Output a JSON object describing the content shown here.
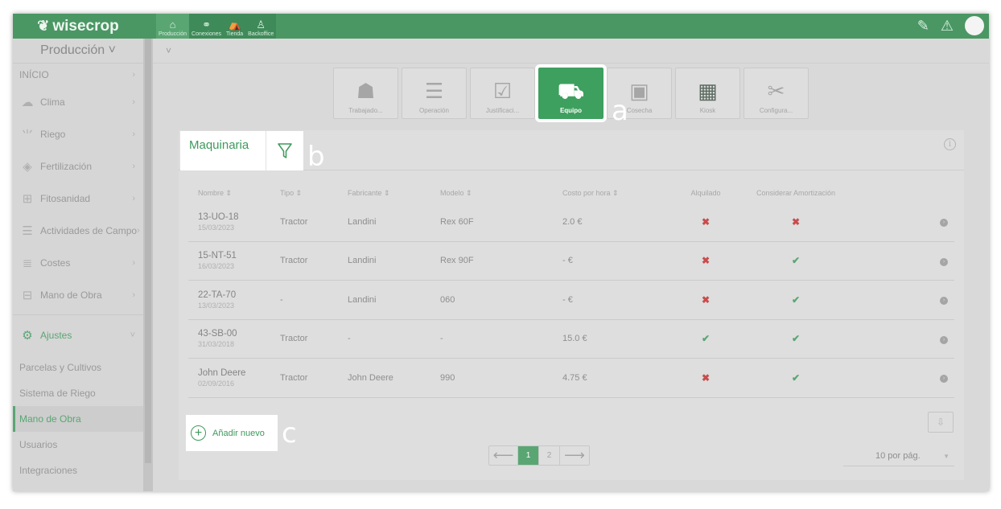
{
  "brand": {
    "name": "wisecrop"
  },
  "topnav": [
    {
      "label": "Producción",
      "icon": "farm-icon",
      "glyph": "⌂"
    },
    {
      "label": "Conexiones",
      "icon": "network-icon",
      "glyph": "⚭"
    },
    {
      "label": "Tienda",
      "icon": "store-icon",
      "glyph": "⛺"
    },
    {
      "label": "Backoffice",
      "icon": "admin-icon",
      "glyph": "♙"
    }
  ],
  "sidebar": {
    "title": "Producción ˅",
    "items": [
      {
        "label": "INÍCIO",
        "icon": "",
        "glyph": ""
      },
      {
        "label": "Clima",
        "icon": "cloud-icon",
        "glyph": "☁"
      },
      {
        "label": "Riego",
        "icon": "sprinkler-icon",
        "glyph": "⺌"
      },
      {
        "label": "Fertilización",
        "icon": "fertilizer-icon",
        "glyph": "◈"
      },
      {
        "label": "Fitosanidad",
        "icon": "medkit-icon",
        "glyph": "⊞"
      },
      {
        "label": "Actividades de Campo",
        "icon": "checklist-icon",
        "glyph": "☰"
      },
      {
        "label": "Costes",
        "icon": "coins-icon",
        "glyph": "≣"
      },
      {
        "label": "Mano de Obra",
        "icon": "worker-icon",
        "glyph": "⊟"
      }
    ],
    "ajustes": {
      "label": "Ajustes",
      "icon": "gear-icon",
      "glyph": "⚙"
    },
    "sub_items": [
      "Parcelas y Cultivos",
      "Sistema de Riego",
      "Mano de Obra",
      "Usuarios",
      "Integraciones"
    ],
    "active_sub": "Mano de Obra"
  },
  "tiles": [
    {
      "label": "Trabajado...",
      "icon": "worker-hat-icon",
      "glyph": "☗"
    },
    {
      "label": "Operación",
      "icon": "checklist-icon",
      "glyph": "☰"
    },
    {
      "label": "Justificaci...",
      "icon": "document-check-icon",
      "glyph": "☑"
    },
    {
      "label": "Equipo",
      "icon": "tractor-icon",
      "glyph": "⛟",
      "active": true
    },
    {
      "label": "Cosecha",
      "icon": "harvest-icon",
      "glyph": "▣"
    },
    {
      "label": "Kiosk",
      "icon": "qr-code-icon",
      "glyph": "▦"
    },
    {
      "label": "Configura...",
      "icon": "tools-icon",
      "glyph": "✂"
    }
  ],
  "callouts": {
    "a": "a",
    "b": "b",
    "c": "c"
  },
  "card": {
    "title": "Maquinaria"
  },
  "table": {
    "columns": [
      "Nombre ⇕",
      "Tipo ⇕",
      "Fabricante ⇕",
      "Modelo ⇕",
      "Costo por hora ⇕",
      "Alquilado",
      "Considerar Amortización"
    ],
    "rows": [
      {
        "name": "13-UO-18",
        "date": "15/03/2023",
        "tipo": "Tractor",
        "fabricante": "Landini",
        "modelo": "Rex 60F",
        "costo": "2.0 €",
        "alquilado": false,
        "amortizacion": false
      },
      {
        "name": "15-NT-51",
        "date": "16/03/2023",
        "tipo": "Tractor",
        "fabricante": "Landini",
        "modelo": "Rex 90F",
        "costo": "- €",
        "alquilado": false,
        "amortizacion": true
      },
      {
        "name": "22-TA-70",
        "date": "13/03/2023",
        "tipo": "-",
        "fabricante": "Landini",
        "modelo": "060",
        "costo": "- €",
        "alquilado": false,
        "amortizacion": true
      },
      {
        "name": "43-SB-00",
        "date": "31/03/2018",
        "tipo": "Tractor",
        "fabricante": "-",
        "modelo": "-",
        "costo": "15.0 €",
        "alquilado": true,
        "amortizacion": true
      },
      {
        "name": "John Deere",
        "date": "02/09/2016",
        "tipo": "Tractor",
        "fabricante": "John Deere",
        "modelo": "990",
        "costo": "4.75 €",
        "alquilado": false,
        "amortizacion": true
      }
    ]
  },
  "add_new": {
    "label": "Añadir nuevo"
  },
  "pagination": {
    "prev": "⟵",
    "next": "⟶",
    "pages": [
      "1",
      "2"
    ],
    "current": "1"
  },
  "per_page": {
    "value": "10 por pág."
  },
  "colors": {
    "brand": "#4a9764",
    "accent": "#3ea05f",
    "error": "#c94c4c"
  }
}
